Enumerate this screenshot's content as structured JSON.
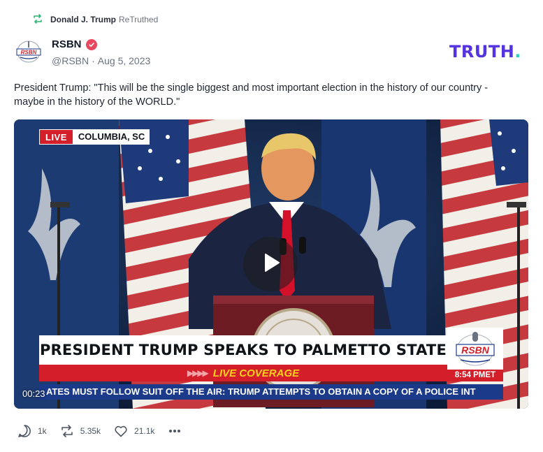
{
  "retruth": {
    "icon": "retruth-icon",
    "name": "Donald J. Trump",
    "action": "ReTruthed"
  },
  "author": {
    "name": "RSBN",
    "handle": "@RSBN",
    "separator": "·",
    "date": "Aug 5, 2023",
    "verified": true,
    "verified_color": "#e8475f",
    "avatar_text": "RSBN"
  },
  "brand": {
    "logo_text": "TRUTH",
    "logo_dot": ".",
    "primary_color": "#5533e0",
    "accent_color": "#2ad3c1"
  },
  "post": {
    "text": "President Trump: \"This will be the single biggest and most important election in the history of our country - maybe in the history of the WORLD.\""
  },
  "video": {
    "live_label": "LIVE",
    "location": "COLUMBIA, SC",
    "headline": "PRESIDENT TRUMP SPEAKS TO PALMETTO STATE",
    "coverage_label": "LIVE COVERAGE",
    "rsbn_logo": "RSBN",
    "broadcast_time": "8:54 PMET",
    "ticker": "ATES MUST FOLLOW SUIT    OFF THE AIR: TRUMP ATTEMPTS TO OBTAIN A COPY OF A POLICE INT",
    "timestamp": "00:23",
    "live_color": "#d41f2a",
    "ticker_color": "#1c3a8a"
  },
  "actions": {
    "replies": "1k",
    "retruths": "5.35k",
    "likes": "21.1k",
    "more_icon": "more-icon"
  }
}
